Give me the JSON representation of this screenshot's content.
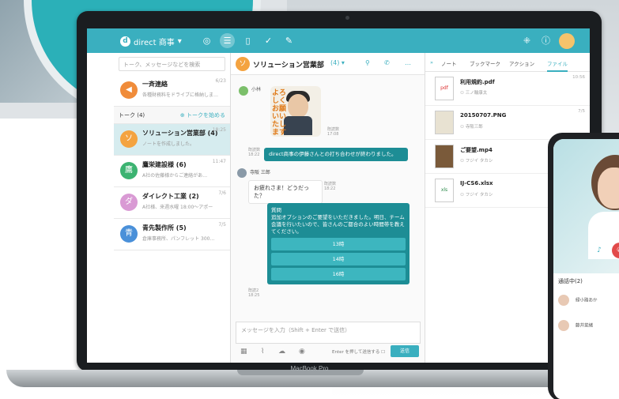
{
  "topbar": {
    "workspace": "direct 商事",
    "workspace_logo": "d"
  },
  "sidebar": {
    "search_placeholder": "トーク、メッセージなどを検索",
    "broadcast": {
      "name": "一斉連絡",
      "preview": "各種財務料をドライブに格納しま…",
      "time": "6/23"
    },
    "talk_header": "トーク (4)",
    "new_talk": "トークを始める",
    "talks": [
      {
        "name": "ソリューション営業部 (4)",
        "preview": "ノートを作成しました。",
        "time": "18:25",
        "avatar": "ソ",
        "color": "#f4a340"
      },
      {
        "name": "鷹栄建設様 (6)",
        "preview": "A社の佐藤様からご連絡があ…",
        "time": "11:47",
        "avatar": "鷹",
        "color": "#3cb371"
      },
      {
        "name": "ダイレクト工業 (2)",
        "preview": "A社様、来週水曜 18:00〜アポー",
        "time": "7/6",
        "avatar": "ダ",
        "color": "#d99ad4"
      },
      {
        "name": "青先製作所 (5)",
        "preview": "倉庫事務所、パンフレット 300…",
        "time": "7/5",
        "avatar": "青",
        "color": "#4a90d9"
      }
    ]
  },
  "chat": {
    "title": "ソリューション営業部",
    "member_count": "(4)",
    "avatar": "ソ",
    "sticker_sender": "小林",
    "sticker_text": "よろしくお願いいたします",
    "sticker_meta": "既読数\n17:08",
    "msg1": "direct商事の伊藤さんとの打ち合わせが終わりました。",
    "msg1_meta": "既読数\n18:22",
    "sender2": "寺阪 三郎",
    "msg2": "お疲れさま！どうだった？",
    "msg2_meta": "既読数\n18:22",
    "q_label": "質問",
    "question": "追加オプションのご要望をいただきました。明日、チーム会議を行いたいので、皆さんのご都合のよい時間帯を教えてください。",
    "options": [
      "13時",
      "14時",
      "16時"
    ],
    "q_meta": "既読2\n18:25",
    "compose_placeholder": "メッセージを入力（Shift + Enter で送信）",
    "enter_label": "Enter を押して送信する",
    "send": "送信"
  },
  "panel": {
    "tabs": [
      "ノート",
      "ブックマーク",
      "アクション",
      "ファイル"
    ],
    "active_tab": "ファイル",
    "files": [
      {
        "name": "利用規約.pdf",
        "user": "三ノ輪康太",
        "time": "10:56",
        "type": "pdf"
      },
      {
        "name": "20150707.PNG",
        "user": "寺阪三郎",
        "time": "7/5",
        "type": "map"
      },
      {
        "name": "ご要望.mp4",
        "user": "フジイ タカシ",
        "time": "",
        "type": "video"
      },
      {
        "name": "IJ-CS6.xlsx",
        "user": "フジイ タカシ",
        "time": "",
        "type": "xls"
      }
    ]
  },
  "device": {
    "label": "MacBook Pro"
  },
  "phone": {
    "call_status": "通話中(2)",
    "participants": [
      "緑小路あか",
      "藤井菜緒"
    ]
  }
}
